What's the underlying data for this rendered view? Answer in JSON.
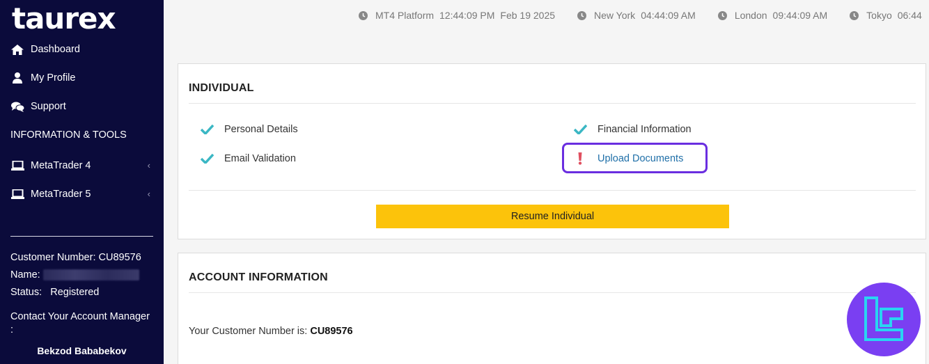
{
  "brand": {
    "logo_text": "taurex"
  },
  "sidebar": {
    "nav": [
      {
        "label": "Dashboard",
        "icon": "home-icon"
      },
      {
        "label": "My Profile",
        "icon": "user-icon"
      },
      {
        "label": "Support",
        "icon": "chat-icon"
      }
    ],
    "section_title": "INFORMATION & TOOLS",
    "tools": [
      {
        "label": "MetaTrader 4",
        "icon": "laptop-icon"
      },
      {
        "label": "MetaTrader 5",
        "icon": "laptop-icon"
      }
    ],
    "customer_number_label": "Customer Number:",
    "customer_number": "CU89576",
    "name_label": "Name:",
    "status_label": "Status:",
    "status_value": "Registered",
    "contact_label": "Contact Your Account Manager",
    "contact_colon": ":",
    "manager_name": "Bekzod Bababekov"
  },
  "clocks": [
    {
      "label": "MT4 Platform",
      "time": "12:44:09 PM",
      "date": "Feb 19 2025"
    },
    {
      "label": "New York",
      "time": "04:44:09 AM"
    },
    {
      "label": "London",
      "time": "09:44:09 AM"
    },
    {
      "label": "Tokyo",
      "time": "06:44"
    }
  ],
  "individual": {
    "title": "INDIVIDUAL",
    "steps": [
      {
        "label": "Personal Details",
        "status": "complete"
      },
      {
        "label": "Email Validation",
        "status": "complete"
      },
      {
        "label": "Financial Information",
        "status": "complete"
      },
      {
        "label": "Upload Documents",
        "status": "pending"
      }
    ],
    "resume_label": "Resume Individual"
  },
  "account_info": {
    "title": "ACCOUNT INFORMATION",
    "customer_prefix": "Your Customer Number is:",
    "customer_number": "CU89576"
  },
  "colors": {
    "sidebar_bg": "#0b0b3b",
    "check": "#3bb7c4",
    "alert": "#e05060",
    "button": "#fcc30b",
    "highlight": "#6a2ee0",
    "badge": "#7a3ff2"
  }
}
